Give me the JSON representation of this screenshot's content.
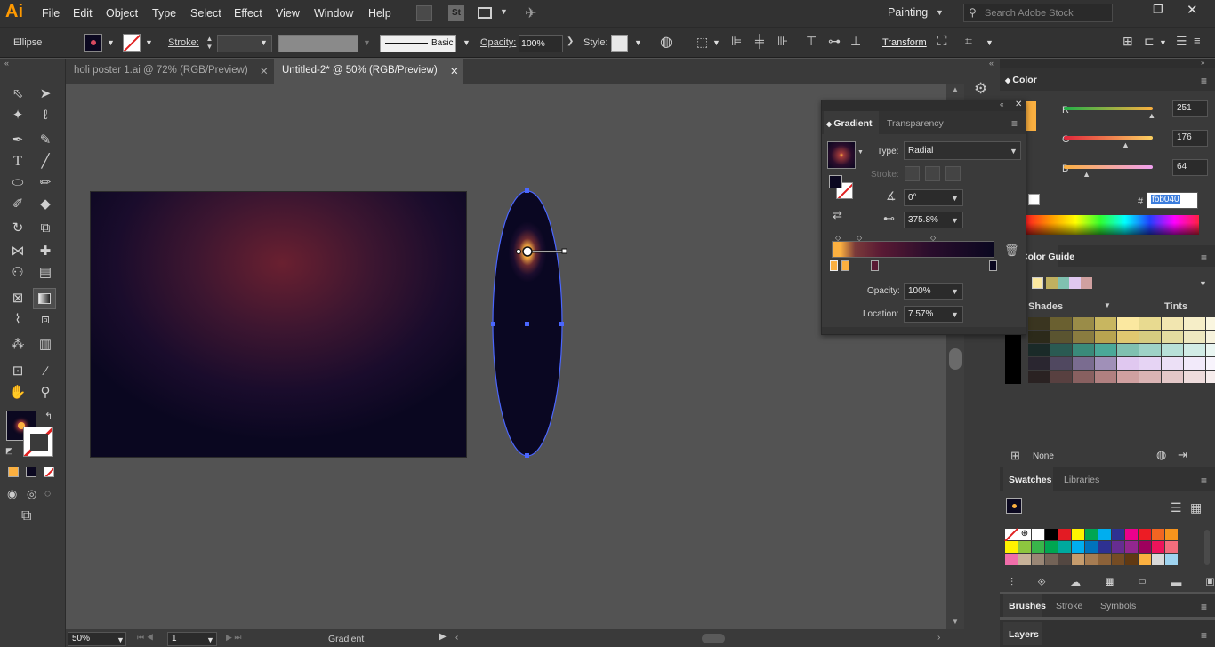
{
  "app": {
    "logo": "Ai",
    "workspace": "Painting",
    "search_placeholder": "Search Adobe Stock",
    "st_badge": "St"
  },
  "menu": [
    "File",
    "Edit",
    "Object",
    "Type",
    "Select",
    "Effect",
    "View",
    "Window",
    "Help"
  ],
  "control": {
    "selection": "Ellipse",
    "stroke_label": "Stroke:",
    "brush": "Basic",
    "opacity_label": "Opacity:",
    "opacity_value": "100%",
    "style_label": "Style:",
    "transform": "Transform"
  },
  "tabs": [
    {
      "label": "holi poster 1.ai @ 72% (RGB/Preview)",
      "active": false
    },
    {
      "label": "Untitled-2* @ 50% (RGB/Preview)",
      "active": true
    }
  ],
  "status": {
    "zoom": "50%",
    "page": "1",
    "tool_name": "Gradient"
  },
  "color_panel": {
    "title": "Color",
    "r": "251",
    "g": "176",
    "b": "64",
    "r_frac": 0.984,
    "g_frac": 0.69,
    "b_frac": 0.251,
    "hex_label": "#",
    "hex": "fbb040"
  },
  "color_guide": {
    "title": "Color Guide",
    "shades": "Shades",
    "tints": "Tints",
    "none": "None"
  },
  "swatches": {
    "title": "Swatches",
    "libraries": "Libraries"
  },
  "bottom_tabs": {
    "brushes": "Brushes",
    "stroke": "Stroke",
    "symbols": "Symbols",
    "layers": "Layers"
  },
  "gradient": {
    "tab": "Gradient",
    "tab2": "Transparency",
    "type_label": "Type:",
    "type": "Radial",
    "stroke_label": "Stroke:",
    "angle": "0°",
    "aspect": "375.8%",
    "opacity_label": "Opacity:",
    "opacity": "100%",
    "location_label": "Location:",
    "location": "7.57%"
  },
  "colors": {
    "accent": "#fbb040",
    "canvas": "#535353",
    "panel": "#3a3a3a",
    "selection": "#4a66ff",
    "dark": "#0e0828",
    "mid": "#5a1a34"
  }
}
